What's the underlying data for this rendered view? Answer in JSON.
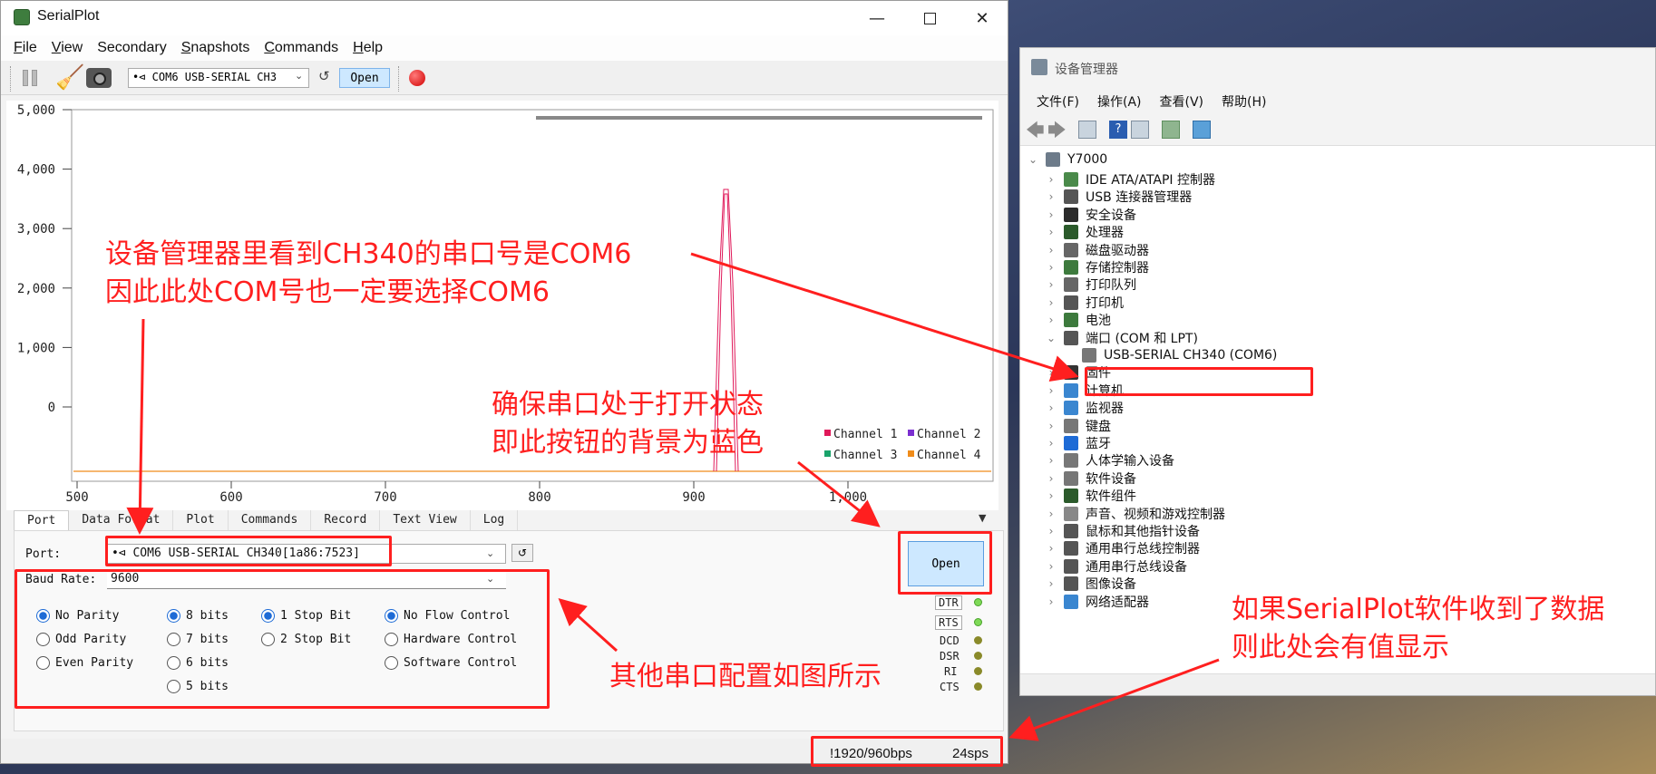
{
  "serialplot": {
    "title": "SerialPlot",
    "menu": [
      {
        "accel": "F",
        "rest": "ile"
      },
      {
        "accel": "V",
        "rest": "iew"
      },
      {
        "accel": "",
        "rest": "Secondary"
      },
      {
        "accel": "S",
        "rest": "napshots"
      },
      {
        "accel": "C",
        "rest": "ommands"
      },
      {
        "accel": "H",
        "rest": "elp"
      }
    ],
    "toolbar": {
      "port_value": "•⊲ COM6 USB-SERIAL CH3",
      "open_label": "Open"
    },
    "plot": {
      "y_ticks": [
        "5,000",
        "4,000",
        "3,000",
        "2,000",
        "1,000",
        "0"
      ],
      "x_ticks": [
        "500",
        "600",
        "700",
        "800",
        "900",
        "1,000"
      ],
      "legend": [
        {
          "name": "Channel 1",
          "color": "#e0195a"
        },
        {
          "name": "Channel 2",
          "color": "#7b2fd0"
        },
        {
          "name": "Channel 3",
          "color": "#1aa36b"
        },
        {
          "name": "Channel 4",
          "color": "#f08c1a"
        }
      ]
    },
    "tabs": [
      "Port",
      "Data Format",
      "Plot",
      "Commands",
      "Record",
      "Text View",
      "Log"
    ],
    "port_tab": {
      "port_label": "Port:",
      "port_value": "•⊲ COM6 USB-SERIAL CH340[1a86:7523]",
      "baud_label": "Baud Rate:",
      "baud_value": "9600",
      "parity": [
        "No Parity",
        "Odd Parity",
        "Even Parity"
      ],
      "data_bits": [
        "8 bits",
        "7 bits",
        "6 bits",
        "5 bits"
      ],
      "stop_bits": [
        "1 Stop Bit",
        "2 Stop Bit"
      ],
      "flow": [
        "No Flow Control",
        "Hardware Control",
        "Software Control"
      ],
      "open_label": "Open",
      "pins_out": [
        "DTR",
        "RTS"
      ],
      "pins_in": [
        "DCD",
        "DSR",
        "RI",
        "CTS"
      ]
    },
    "status": {
      "bps": "!1920/960bps",
      "sps": "24sps"
    }
  },
  "device_manager": {
    "title": "设备管理器",
    "menu": [
      "文件(F)",
      "操作(A)",
      "查看(V)",
      "帮助(H)"
    ],
    "root": "Y7000",
    "items": [
      "IDE ATA/ATAPI 控制器",
      "USB 连接器管理器",
      "安全设备",
      "处理器",
      "磁盘驱动器",
      "存储控制器",
      "打印队列",
      "打印机",
      "电池",
      "端口 (COM 和 LPT)",
      "USB-SERIAL CH340 (COM6)",
      "固件",
      "计算机",
      "监视器",
      "键盘",
      "蓝牙",
      "人体学输入设备",
      "软件设备",
      "软件组件",
      "声音、视频和游戏控制器",
      "鼠标和其他指针设备",
      "通用串行总线控制器",
      "通用串行总线设备",
      "图像设备",
      "网络适配器"
    ]
  },
  "annotations": {
    "com_line1": "设备管理器里看到CH340的串口号是COM6",
    "com_line2": "因此此处COM号也一定要选择COM6",
    "open_line1": "确保串口处于打开状态",
    "open_line2": "即此按钮的背景为蓝色",
    "config": "其他串口配置如图所示",
    "data_line1": "如果SerialPlot软件收到了数据",
    "data_line2": "则此处会有值显示"
  }
}
